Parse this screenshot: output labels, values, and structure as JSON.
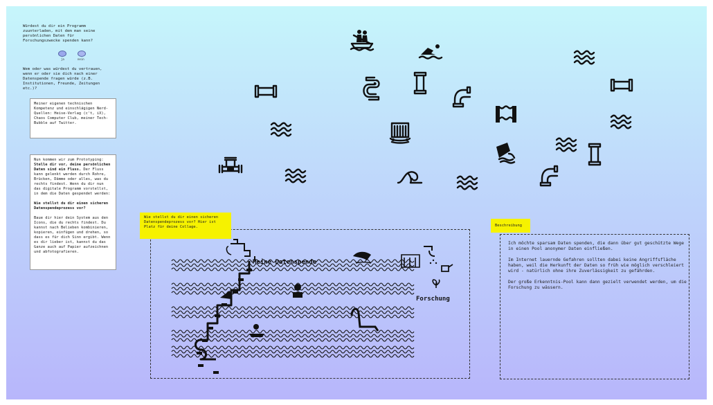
{
  "survey": {
    "q1": "Würdest du dir ein Programm zuunterladen, mit dem man seine persönlichen Daten für Forschungszwecke spenden kann?",
    "option_yes": "ja",
    "option_no": "nein",
    "q2": "Wem oder was würdest du vertrauen, wenn er oder sie dich nach einer Datenspende fragen würde (z.B. Institutionen, Freunde, Zeitungen etc.)?",
    "answer2": "Meiner eigenen technischen Kompetenz und einschlägigen Nerd-Quellen: Heise-Verlag (c't, iX), Chaos Computer Club, meiner Tech-Bubble auf Twitter.",
    "intro_p1": "Nun kommen wir zum Prototyping:",
    "intro_bold": "Stelle dir vor, deine persönlichen Daten sind ein Fluss.",
    "intro_p2": " Der Fluss kann gelenkt werden durch Rohre, Brücken, Dämme oder alles, was du rechts findest. Wenn du dir nun das digitale Programm vorstellst, in dem die Daten gespendet werden:",
    "intro_q": "Wie stellst du dir einen sicheren Datenspendeprozess vor?",
    "intro_p3": "Baue dir hier dein System aus den Icons, die du rechts findest. Du kannst nach Belieben kombinieren, kopieren, einfügen und drehen, so dass es für dich Sinn ergibt. Wenn es dir lieber ist, kannst du das Ganze auch auf Papier aufzeichnen und abfotografieren."
  },
  "collage": {
    "prompt": "Wie stellst du dir einen sicheren Datenspendeprozess vor? Hier ist Platz für deine Collage.",
    "label_start": "Meine Datenspende",
    "label_end": "Forschung"
  },
  "description": {
    "title": "Beschreibung",
    "text": "Ich möchte sparsam Daten spenden, die dann über gut geschützte Wege in einen Pool anonymer Daten einfließen.\n\nIm Internet lauernde Gefahren sollten dabei keine Angriffsfläche haben, weil die Herkunft der Daten so früh wie möglich verschleiert wird - natürlich ohne ihre Zuverlässigkeit zu gefährden.\n\nDer große Erkenntnis-Pool kann dann gezielt verwendet werden, um die Forschung zu wässern."
  },
  "palette": [
    "rowboat-icon",
    "swimmer-icon",
    "waves-icon",
    "pipe-straight-horizontal-icon",
    "pipe-s-curve-icon",
    "pipe-straight-vertical-icon",
    "pipe-elbow-icon",
    "pipe-straight-horizontal-icon",
    "dam-icon",
    "waves-icon",
    "waterfall-icon",
    "waves-icon",
    "waves-icon",
    "floodgate-icon",
    "pipe-straight-vertical-icon",
    "valve-icon",
    "waves-icon",
    "wave-icon",
    "waves-icon",
    "pipe-elbow-icon"
  ],
  "colors": {
    "sticky": "#f6f200",
    "board_top": "#c6f6fb",
    "board_bottom": "#b8b6fb"
  }
}
